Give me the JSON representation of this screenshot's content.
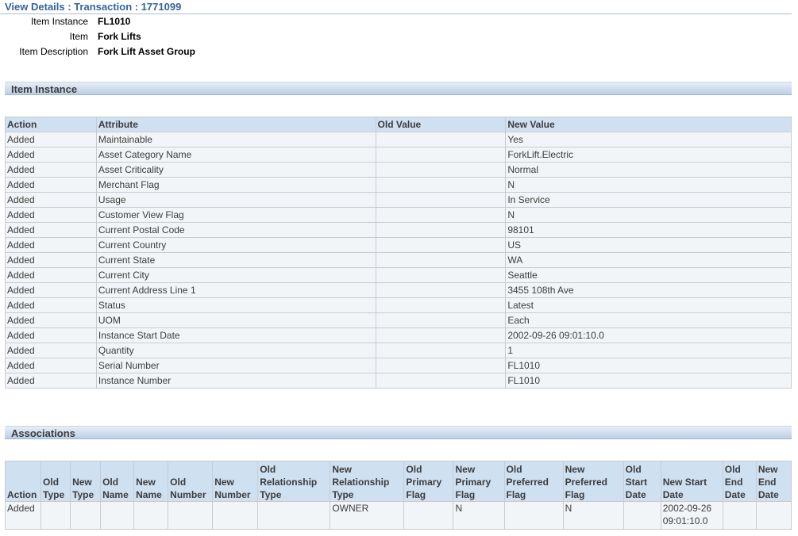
{
  "page": {
    "title": "View Details : Transaction : 1771099"
  },
  "details": [
    {
      "label": "Item Instance",
      "value": "FL1010"
    },
    {
      "label": "Item",
      "value": "Fork Lifts"
    },
    {
      "label": "Item Description",
      "value": "Fork Lift Asset Group"
    }
  ],
  "item_instance_section": {
    "title": "Item Instance",
    "columns": [
      "Action",
      "Attribute",
      "Old Value",
      "New Value"
    ],
    "rows": [
      [
        "Added",
        "Maintainable",
        "",
        "Yes"
      ],
      [
        "Added",
        "Asset Category Name",
        "",
        "ForkLift.Electric"
      ],
      [
        "Added",
        "Asset Criticality",
        "",
        "Normal"
      ],
      [
        "Added",
        "Merchant Flag",
        "",
        "N"
      ],
      [
        "Added",
        "Usage",
        "",
        "In Service"
      ],
      [
        "Added",
        "Customer View Flag",
        "",
        "N"
      ],
      [
        "Added",
        "Current Postal Code",
        "",
        "98101"
      ],
      [
        "Added",
        "Current Country",
        "",
        "US"
      ],
      [
        "Added",
        "Current State",
        "",
        "WA"
      ],
      [
        "Added",
        "Current City",
        "",
        "Seattle"
      ],
      [
        "Added",
        "Current Address Line 1",
        "",
        "3455 108th Ave"
      ],
      [
        "Added",
        "Status",
        "",
        "Latest"
      ],
      [
        "Added",
        "UOM",
        "",
        "Each"
      ],
      [
        "Added",
        "Instance Start Date",
        "",
        "2002-09-26 09:01:10.0"
      ],
      [
        "Added",
        "Quantity",
        "",
        "1"
      ],
      [
        "Added",
        "Serial Number",
        "",
        "FL1010"
      ],
      [
        "Added",
        "Instance Number",
        "",
        "FL1010"
      ]
    ]
  },
  "associations_section": {
    "title": "Associations",
    "columns": [
      [
        "Action"
      ],
      [
        "Old",
        "Type"
      ],
      [
        "New",
        "Type"
      ],
      [
        "Old",
        "Name"
      ],
      [
        "New",
        "Name"
      ],
      [
        "Old",
        "Number"
      ],
      [
        "New",
        "Number"
      ],
      [
        "Old",
        "Relationship",
        "Type"
      ],
      [
        "New",
        "Relationship",
        "Type"
      ],
      [
        "Old",
        "Primary",
        "Flag"
      ],
      [
        "New",
        "Primary",
        "Flag"
      ],
      [
        "Old",
        "Preferred",
        "Flag"
      ],
      [
        "New",
        "Preferred",
        "Flag"
      ],
      [
        "Old",
        "Start",
        "Date"
      ],
      [
        "New Start",
        "Date"
      ],
      [
        "Old",
        "End",
        "Date"
      ],
      [
        "New",
        "End",
        "Date"
      ]
    ],
    "rows": [
      [
        [
          "Added"
        ],
        [
          ""
        ],
        [
          ""
        ],
        [
          ""
        ],
        [
          ""
        ],
        [
          ""
        ],
        [
          ""
        ],
        [
          ""
        ],
        [
          "OWNER"
        ],
        [
          ""
        ],
        [
          "N"
        ],
        [
          ""
        ],
        [
          "N"
        ],
        [
          ""
        ],
        [
          "2002-09-26",
          "09:01:10.0"
        ],
        [
          ""
        ],
        [
          ""
        ]
      ]
    ]
  }
}
